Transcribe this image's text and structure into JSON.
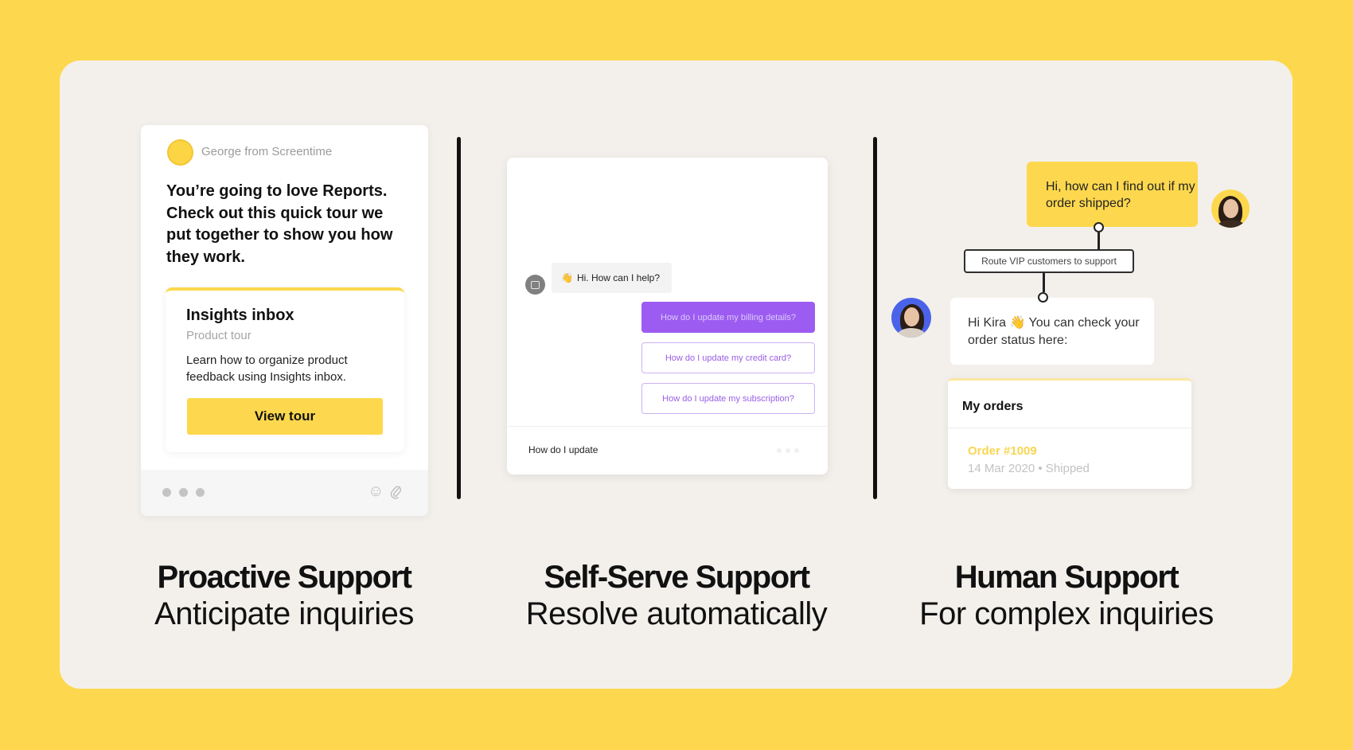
{
  "colors": {
    "background": "#fdd84e",
    "panel": "#f3f0ec",
    "accent_yellow": "#fdd84e",
    "accent_purple": "#9d5cf1",
    "agent_avatar_blue": "#4a63e8"
  },
  "proactive": {
    "sender": "George from Screentime",
    "headline": "You’re going to love Reports. Check out this quick tour we put together to show you how they work.",
    "tour_card": {
      "title": "Insights inbox",
      "subtitle": "Product tour",
      "description": "Learn how to organize product feedback using Insights inbox.",
      "button_label": "View tour"
    },
    "footer_icons": [
      "emoji-icon",
      "paperclip-icon"
    ],
    "caption_title": "Proactive Support",
    "caption_subtitle": "Anticipate inquiries"
  },
  "self_serve": {
    "bot_greeting_emoji": "👋",
    "bot_greeting": "Hi. How can I help?",
    "suggestions": [
      {
        "label": "How do I update my billing details?",
        "selected": true
      },
      {
        "label": "How do I update my credit card?",
        "selected": false
      },
      {
        "label": "How do I update my subscription?",
        "selected": false
      }
    ],
    "composer_value": "How do I update",
    "caption_title": "Self-Serve Support",
    "caption_subtitle": "Resolve automatically"
  },
  "human": {
    "customer_message": "Hi, how can I find out if my order shipped?",
    "routing_rule": "Route VIP customers to support",
    "agent_message_prefix": "Hi Kira",
    "agent_message_emoji": "👋",
    "agent_message_rest": "You can check your order status here:",
    "orders": {
      "title": "My orders",
      "order_number": "Order #1009",
      "order_meta": "14 Mar 2020 • Shipped"
    },
    "caption_title": "Human Support",
    "caption_subtitle": "For complex inquiries"
  }
}
